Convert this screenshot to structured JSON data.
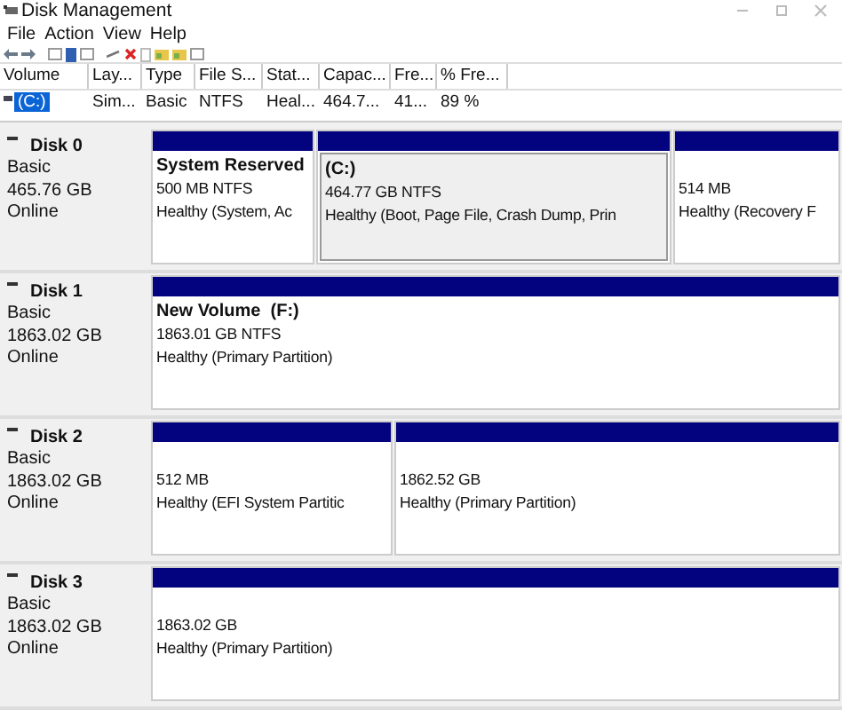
{
  "window": {
    "title": "Disk Management"
  },
  "menu": [
    "File",
    "Action",
    "View",
    "Help"
  ],
  "table": {
    "columns": [
      "Volume",
      "Lay...",
      "Type",
      "File S...",
      "Stat...",
      "Capac...",
      "Fre...",
      "% Fre..."
    ],
    "rows": [
      {
        "selected": true,
        "cells": [
          "(C:)",
          "Sim...",
          "Basic",
          "NTFS",
          "Heal...",
          "464.7...",
          "41...",
          "89 %"
        ]
      }
    ]
  },
  "disks": [
    {
      "name": "Disk 0",
      "type": "Basic",
      "size": "465.76 GB",
      "status": "Online",
      "partitions": [
        {
          "name": "System Reserved",
          "size": "500 MB NTFS",
          "status": "Healthy (System, Ac",
          "selected": false
        },
        {
          "name": "(C:)",
          "size": "464.77 GB NTFS",
          "status": "Healthy (Boot, Page File, Crash Dump, Prin",
          "selected": true
        },
        {
          "size": "514 MB",
          "status": "Healthy (Recovery F",
          "selected": false
        }
      ]
    },
    {
      "name": "Disk 1",
      "type": "Basic",
      "size": "1863.02 GB",
      "status": "Online",
      "partitions": [
        {
          "name": "New Volume  (F:)",
          "size": "1863.01 GB NTFS",
          "status": "Healthy (Primary Partition)",
          "selected": false
        }
      ]
    },
    {
      "name": "Disk 2",
      "type": "Basic",
      "size": "1863.02 GB",
      "status": "Online",
      "partitions": [
        {
          "size": "512 MB",
          "status": "Healthy (EFI System Partitic",
          "selected": false
        },
        {
          "size": "1862.52 GB",
          "status": "Healthy (Primary Partition)",
          "selected": false
        }
      ]
    },
    {
      "name": "Disk 3",
      "type": "Basic",
      "size": "1863.02 GB",
      "status": "Online",
      "partitions": [
        {
          "size": "1863.02 GB",
          "status": "Healthy (Primary Partition)",
          "selected": false
        }
      ]
    }
  ]
}
